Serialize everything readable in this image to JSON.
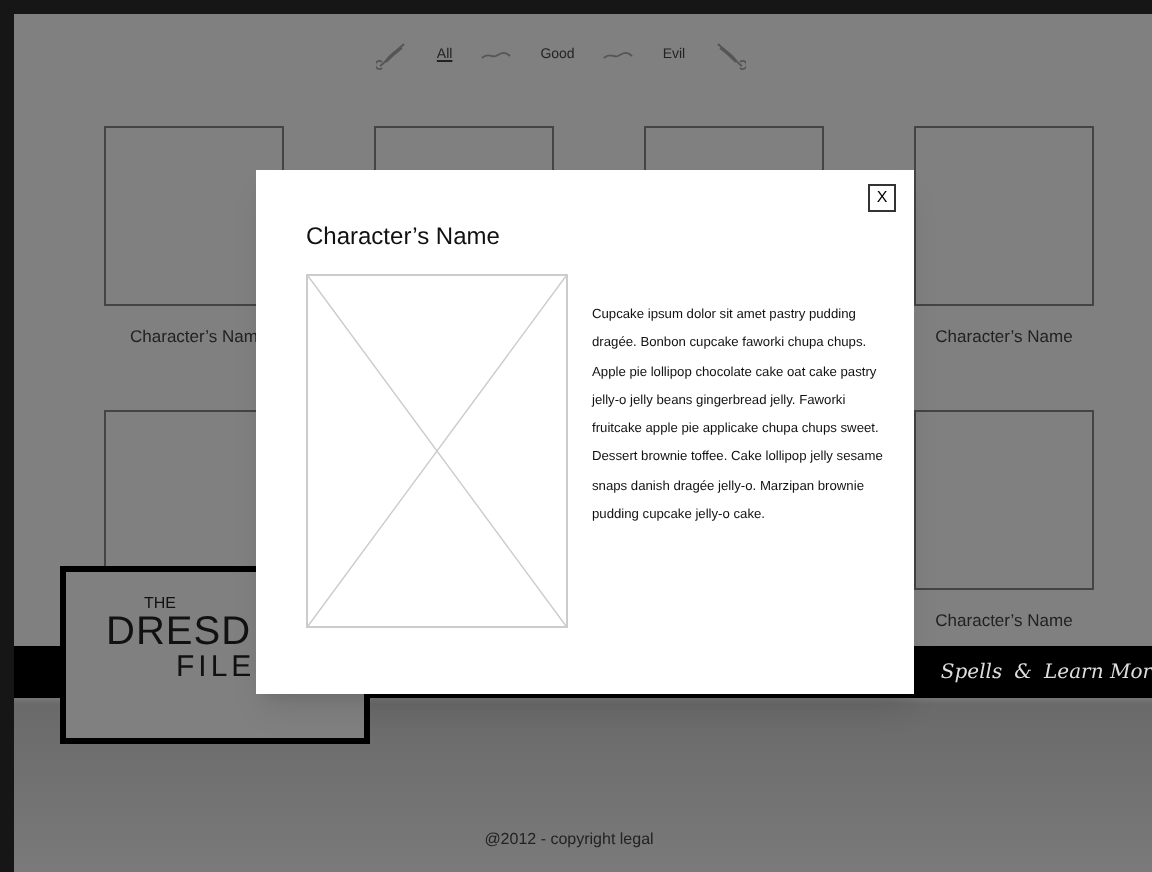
{
  "filters": [
    {
      "label": "All",
      "selected": true
    },
    {
      "label": "Good",
      "selected": false
    },
    {
      "label": "Evil",
      "selected": false
    }
  ],
  "characters": [
    {
      "kind": "named",
      "name": "Character’s Nam"
    },
    {
      "kind": "covered"
    },
    {
      "kind": "covered"
    },
    {
      "kind": "named",
      "name": "Character’s Name"
    },
    {
      "kind": "covered"
    },
    {
      "kind": "hidden"
    },
    {
      "kind": "hidden"
    },
    {
      "kind": "named",
      "name": "Character’s Name"
    }
  ],
  "logo": {
    "line_1": "THE",
    "line_2": "DRESD",
    "line_3": "FILE"
  },
  "nav_links": [
    "Spells",
    "&",
    "Learn Mor"
  ],
  "modal": {
    "title": "Character’s Name",
    "close": "X",
    "description": "Cupcake ipsum dolor sit amet pastry pudding dragée. Bonbon cupcake faworki chupa chups. Apple pie lollipop chocolate cake oat cake pastry jelly-o jelly beans gingerbread jelly. Faworki fruitcake apple pie applicake chupa chups sweet. Dessert brownie toffee. Cake lollipop jelly sesame snaps danish dragée jelly-o. Marzipan brownie pudding cupcake jelly-o cake."
  },
  "footer": "@2012 - copyright legal"
}
